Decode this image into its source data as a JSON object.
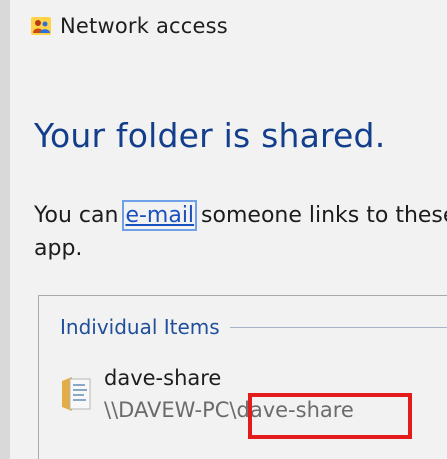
{
  "window": {
    "title": "Network access",
    "title_icon": "network-users-icon"
  },
  "main": {
    "heading": "Your folder is shared.",
    "body_prefix": "You can ",
    "email_link": "e-mail",
    "body_suffix": " someone links to these",
    "body_line2": "app."
  },
  "individual_items": {
    "label": "Individual Items",
    "items": [
      {
        "name": "dave-share",
        "path": "\\\\DAVEW-PC\\dave-share",
        "icon": "shared-folder-icon"
      }
    ]
  },
  "colors": {
    "heading": "#123e8c",
    "link": "#1a4fbf",
    "group_label": "#1f4e9a",
    "highlight": "#e31b1b"
  }
}
